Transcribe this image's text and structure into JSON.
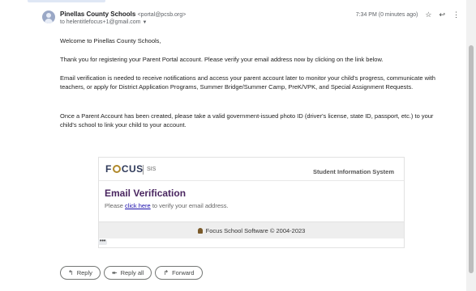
{
  "email": {
    "sender_name": "Pinellas County Schools",
    "sender_email": "<portal@pcsb.org>",
    "to_line": "to helentitlefocus+1@gmail.com",
    "timestamp": "7:34 PM (0 minutes ago)",
    "icons": {
      "star": "star-icon",
      "reply": "reply-icon",
      "more": "more-vertical-icon"
    },
    "body": {
      "greeting": "Welcome to Pinellas County Schools,",
      "p1": "Thank you for registering your Parent Portal account. Please verify your email address now by clicking on the link below.",
      "p2": "Email verification is needed to receive notifications and access your parent account later to monitor your child's progress, communicate with teachers, or apply for District Application Programs, Summer Bridge/Summer Camp, PreK/VPK, and Special Assignment Requests.",
      "p3": "Once a Parent Account has been created, please take a valid government-issued photo ID (driver's license, state ID, passport, etc.) to your child's school to link your child to your account."
    },
    "card": {
      "logo_text_pre": "F",
      "logo_text_post": "CUS",
      "logo_sub": "SIS",
      "system_name": "Student Information System",
      "title": "Email Verification",
      "text_pre": "Please",
      "link_text": "click here",
      "text_post": "to verify your email address.",
      "footer": "Focus School Software © 2004-2023"
    },
    "more_dots": "•••"
  },
  "actions": {
    "reply": "Reply",
    "reply_all": "Reply all",
    "forward": "Forward"
  },
  "colors": {
    "brand_purple": "#4a2660",
    "link_blue": "#1a0dab",
    "logo_gold": "#b0892a"
  }
}
